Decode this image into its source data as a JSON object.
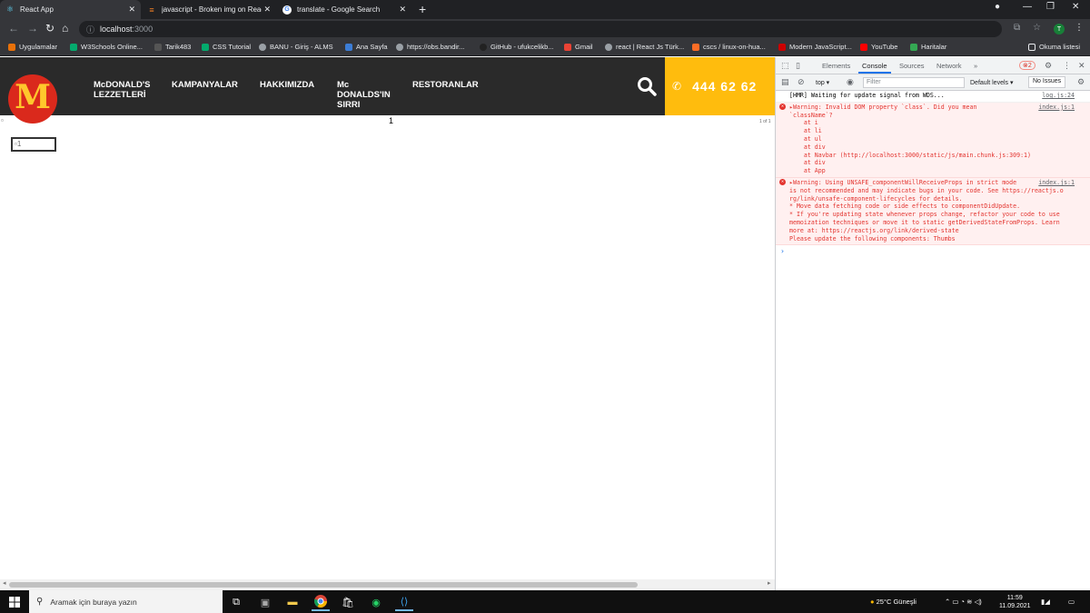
{
  "browser": {
    "tabs": [
      {
        "title": "React App",
        "active": true
      },
      {
        "title": "javascript - Broken img on React",
        "active": false
      },
      {
        "title": "translate - Google Search",
        "active": false
      }
    ],
    "new_tab": "+",
    "url_host": "localhost",
    "url_port": ":3000",
    "profile_initial": "T",
    "bookmarks": [
      "Uygulamalar",
      "W3Schools Online...",
      "Tarik483",
      "CSS Tutorial",
      "BANU - Giriş - ALMS",
      "Ana Sayfa",
      "https://obs.bandir...",
      "GitHub - ufukcelikb...",
      "Gmail",
      "react | React Js Türk...",
      "cscs / linux-on-hua...",
      "Modern JavaScript...",
      "YouTube",
      "Haritalar"
    ],
    "reading_list": "Okuma listesi"
  },
  "site": {
    "logo": "M",
    "nav": [
      "McDONALD'S\nLEZZETLERİ",
      "KAMPANYALAR",
      "HAKKIMIZDA",
      "Mc\nDONALDS'IN\nSIRRI",
      "RESTORANLAR"
    ],
    "phone": "444 62 62",
    "carousel_number": "1",
    "slide_status": "1 of 1",
    "thumb_alt": "1",
    "accent": "#ffbc0d",
    "header_bg": "#2a2a2a",
    "logo_red": "#da291c"
  },
  "devtools": {
    "tabs": [
      "Elements",
      "Console",
      "Sources",
      "Network",
      "»"
    ],
    "error_count": "2",
    "context": "top ▾",
    "filter_placeholder": "Filter",
    "levels": "Default levels ▾",
    "issues": "No Issues",
    "messages": [
      {
        "type": "log",
        "lines": [
          "[HMR] Waiting for update signal from WDS..."
        ],
        "source": "log.js:24"
      },
      {
        "type": "error",
        "lines": [
          "▸Warning: Invalid DOM property `class`. Did you mean",
          "`className`?",
          "    at i",
          "    at li",
          "    at ul",
          "    at div",
          "    at Navbar (http://localhost:3000/static/js/main.chunk.js:309:1)",
          "    at div",
          "    at App"
        ],
        "source": "index.js:1"
      },
      {
        "type": "error",
        "lines": [
          "▸Warning: Using UNSAFE_componentWillReceiveProps in strict mode",
          "is not recommended and may indicate bugs in your code. See https://reactjs.o",
          "rg/link/unsafe-component-lifecycles for details.",
          "",
          "* Move data fetching code or side effects to componentDidUpdate.",
          "* If you're updating state whenever props change, refactor your code to use",
          "memoization techniques or move it to static getDerivedStateFromProps. Learn",
          "more at: https://reactjs.org/link/derived-state",
          "",
          "Please update the following components: Thumbs"
        ],
        "source": "index.js:1"
      }
    ],
    "prompt": "›"
  },
  "taskbar": {
    "search_placeholder": "Aramak için buraya yazın",
    "weather": "25°C  Güneşli",
    "time": "11:59",
    "date": "11.09.2021"
  }
}
